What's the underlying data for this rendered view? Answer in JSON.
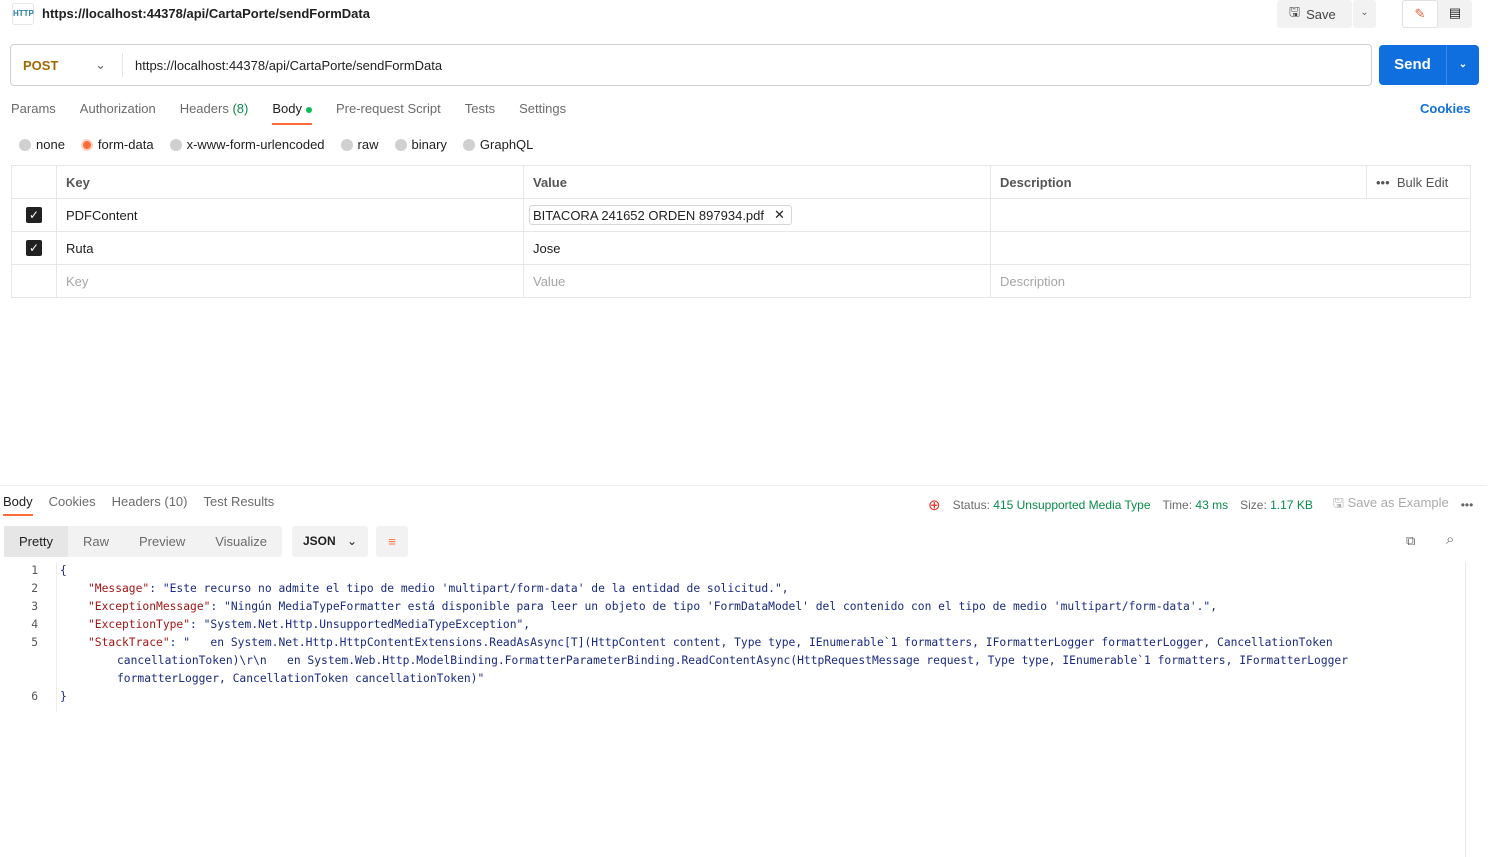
{
  "header": {
    "tab_icon": "HTTP",
    "title": "https://localhost:44378/api/CartaPorte/sendFormData",
    "save_label": "Save"
  },
  "request": {
    "method": "POST",
    "url": "https://localhost:44378/api/CartaPorte/sendFormData",
    "send_label": "Send"
  },
  "tabs": [
    {
      "label": "Params"
    },
    {
      "label": "Authorization"
    },
    {
      "label": "Headers",
      "count": "(8)"
    },
    {
      "label": "Body"
    },
    {
      "label": "Pre-request Script"
    },
    {
      "label": "Tests"
    },
    {
      "label": "Settings"
    }
  ],
  "cookies_label": "Cookies",
  "body_types": [
    "none",
    "form-data",
    "x-www-form-urlencoded",
    "raw",
    "binary",
    "GraphQL"
  ],
  "selected_body_type": "form-data",
  "form_table": {
    "headers": {
      "key": "Key",
      "value": "Value",
      "description": "Description",
      "bulk_edit": "Bulk Edit"
    },
    "rows": [
      {
        "checked": true,
        "key": "PDFContent",
        "value": "BITACORA 241652 ORDEN 897934.pdf"
      },
      {
        "checked": true,
        "key": "Ruta",
        "value": "Jose"
      }
    ],
    "placeholders": {
      "key": "Key",
      "value": "Value",
      "description": "Description"
    }
  },
  "response": {
    "tabs": [
      "Body",
      "Cookies",
      "Headers (10)",
      "Test Results"
    ],
    "status_label": "Status:",
    "status": "415 Unsupported Media Type",
    "time_label": "Time:",
    "time": "43 ms",
    "size_label": "Size:",
    "size": "1.17 KB",
    "save_example": "Save as Example",
    "views": [
      "Pretty",
      "Raw",
      "Preview",
      "Visualize"
    ],
    "format": "JSON",
    "lines": [
      {
        "n": "1",
        "text": "{"
      },
      {
        "n": "2",
        "key": "\"Message\"",
        "text": ": \"Este recurso no admite el tipo de medio 'multipart/form-data' de la entidad de solicitud.\","
      },
      {
        "n": "3",
        "key": "\"ExceptionMessage\"",
        "text": ": \"Ningún MediaTypeFormatter está disponible para leer un objeto de tipo 'FormDataModel' del contenido con el tipo de medio 'multipart/form-data'.\","
      },
      {
        "n": "4",
        "key": "\"ExceptionType\"",
        "text": ": \"System.Net.Http.UnsupportedMediaTypeException\","
      },
      {
        "n": "5",
        "key": "\"StackTrace\"",
        "text": ": \"   en System.Net.Http.HttpContentExtensions.ReadAsAsync[T](HttpContent content, Type type, IEnumerable`1 formatters, IFormatterLogger formatterLogger, CancellationToken",
        "cont": [
          "cancellationToken)\\r\\n   en System.Web.Http.ModelBinding.FormatterParameterBinding.ReadContentAsync(HttpRequestMessage request, Type type, IEnumerable`1 formatters, IFormatterLogger",
          "formatterLogger, CancellationToken cancellationToken)\""
        ]
      },
      {
        "n": "6",
        "text": "}"
      }
    ]
  },
  "colors": {
    "accent": "#ff6c37",
    "send": "#0f6fde",
    "status_ok_text": "#0a8a4a",
    "json_key": "#a31515",
    "json_value": "#1a2a80"
  }
}
